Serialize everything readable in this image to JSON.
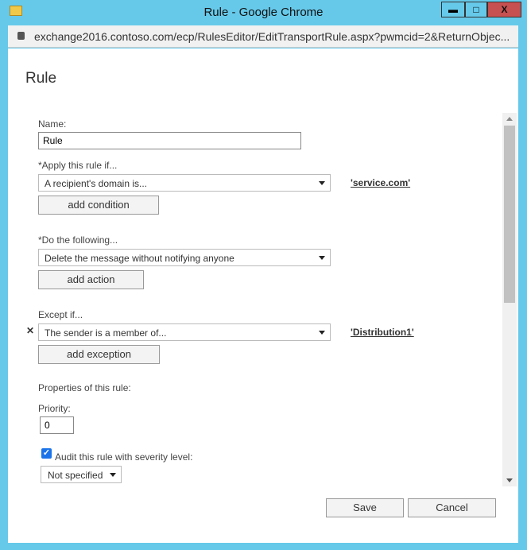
{
  "window": {
    "title": "Rule - Google Chrome",
    "minimize": "▬",
    "maximize": "□",
    "close": "X"
  },
  "address_bar": {
    "url": "exchange2016.contoso.com/ecp/RulesEditor/EditTransportRule.aspx?pwmcid=2&ReturnObjec..."
  },
  "form": {
    "heading": "Rule",
    "name_label": "Name:",
    "name_value": "Rule",
    "apply_label": "*Apply this rule if...",
    "apply_value": "A recipient's domain is...",
    "apply_link": "'service.com'",
    "add_condition": "add condition",
    "do_label": "*Do the following...",
    "do_value": "Delete the message without notifying anyone",
    "add_action": "add action",
    "except_label": "Except if...",
    "except_remove": "✕",
    "except_value": "The sender is a member of...",
    "except_link": "'Distribution1'",
    "add_exception": "add exception",
    "properties_label": "Properties of this rule:",
    "priority_label": "Priority:",
    "priority_value": "0",
    "audit_checked": true,
    "audit_check_glyph": "✓",
    "audit_label": "Audit this rule with severity level:",
    "severity_value": "Not specified"
  },
  "buttons": {
    "save": "Save",
    "cancel": "Cancel"
  }
}
